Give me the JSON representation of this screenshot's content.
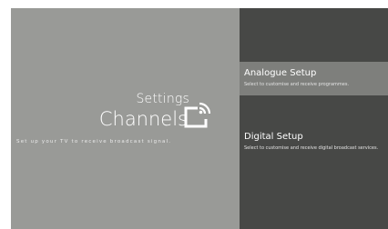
{
  "header": {
    "breadcrumb": "Settings",
    "title": "Channels",
    "description": "Set up your TV to receive broadcast signal.",
    "icon": "tv-signal-icon"
  },
  "menu": {
    "items": [
      {
        "title": "Analogue Setup",
        "subtitle": "Select to customise and receive programmes.",
        "selected": true
      },
      {
        "title": "Digital Setup",
        "subtitle": "Select to customise and receive digital broadcast services.",
        "selected": false
      }
    ]
  },
  "colors": {
    "left_pane": "#999a97",
    "right_pane": "#474846",
    "selected_item": "#7e7f7c",
    "text": "#ffffff"
  }
}
